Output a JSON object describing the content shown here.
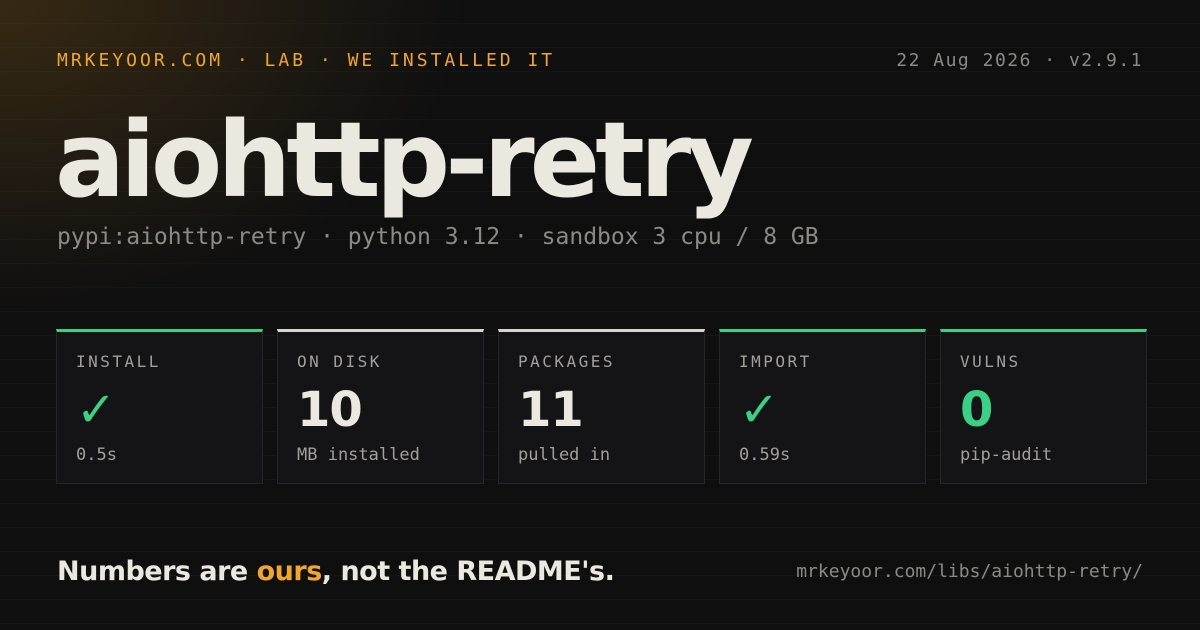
{
  "header": {
    "kicker": "MRKEYOOR.COM · LAB · WE INSTALLED IT",
    "meta": "22 Aug 2026 · v2.9.1"
  },
  "package": {
    "name": "aiohttp-retry",
    "details": "pypi:aiohttp-retry · python 3.12 · sandbox 3 cpu / 8 GB"
  },
  "stats": [
    {
      "label": "INSTALL",
      "value": "✓",
      "note": "0.5s",
      "status": "good"
    },
    {
      "label": "ON DISK",
      "value": "10",
      "note": "MB installed",
      "status": "neutral"
    },
    {
      "label": "PACKAGES",
      "value": "11",
      "note": "pulled in",
      "status": "neutral"
    },
    {
      "label": "IMPORT",
      "value": "✓",
      "note": "0.59s",
      "status": "good"
    },
    {
      "label": "VULNS",
      "value": "0",
      "note": "pip-audit",
      "status": "good"
    }
  ],
  "footer": {
    "tagline_before": "Numbers are ",
    "tagline_accent": "ours",
    "tagline_after": ", not the README's.",
    "url": "mrkeyoor.com/libs/aiohttp-retry/"
  },
  "colors": {
    "accent": "#f0a52e",
    "good": "#3ccf86",
    "neutral": "#d9d6cf",
    "background": "#0f0f10"
  }
}
